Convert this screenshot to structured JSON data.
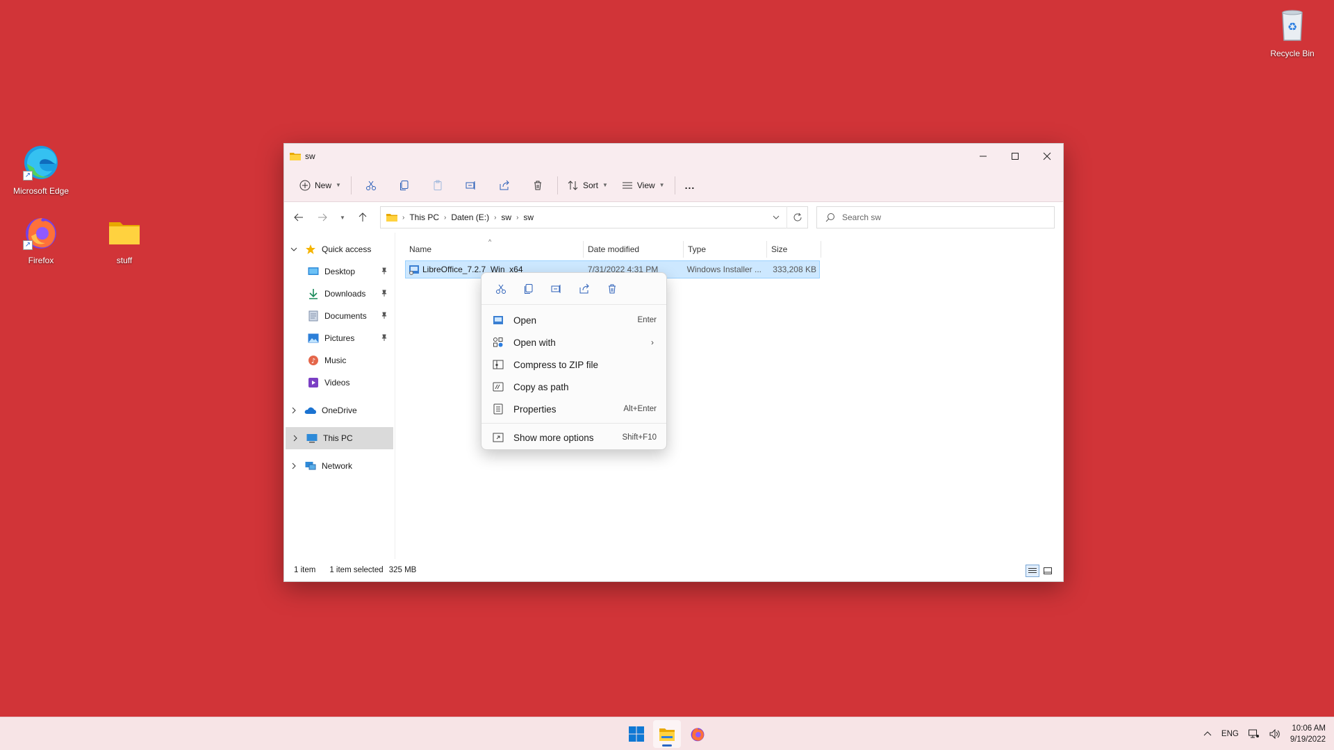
{
  "desktop": {
    "icons": [
      {
        "label": "Microsoft Edge"
      },
      {
        "label": "Firefox"
      },
      {
        "label": "stuff"
      },
      {
        "label": "Recycle Bin"
      }
    ]
  },
  "window": {
    "title": "sw",
    "toolbar": {
      "new_label": "New",
      "sort_label": "Sort",
      "view_label": "View",
      "more_label": "..."
    },
    "address": {
      "crumbs": [
        "This PC",
        "Daten (E:)",
        "sw",
        "sw"
      ]
    },
    "search": {
      "placeholder": "Search sw"
    },
    "nav": {
      "quick_access": "Quick access",
      "items": [
        {
          "label": "Desktop",
          "icon": "desktop-icon"
        },
        {
          "label": "Downloads",
          "icon": "downloads-icon"
        },
        {
          "label": "Documents",
          "icon": "documents-icon"
        },
        {
          "label": "Pictures",
          "icon": "pictures-icon"
        },
        {
          "label": "Music",
          "icon": "music-icon"
        },
        {
          "label": "Videos",
          "icon": "videos-icon"
        }
      ],
      "onedrive": "OneDrive",
      "this_pc": "This PC",
      "network": "Network"
    },
    "columns": {
      "name": "Name",
      "date": "Date modified",
      "type": "Type",
      "size": "Size"
    },
    "files": [
      {
        "name": "LibreOffice_7.2.7_Win_x64",
        "date": "7/31/2022 4:31 PM",
        "type": "Windows Installer ...",
        "size": "333,208 KB"
      }
    ],
    "status": {
      "count": "1 item",
      "selected": "1 item selected",
      "size": "325 MB"
    }
  },
  "context_menu": {
    "items": [
      {
        "label": "Open",
        "shortcut": "Enter"
      },
      {
        "label": "Open with",
        "shortcut": ""
      },
      {
        "label": "Compress to ZIP file",
        "shortcut": ""
      },
      {
        "label": "Copy as path",
        "shortcut": ""
      },
      {
        "label": "Properties",
        "shortcut": "Alt+Enter"
      },
      {
        "label": "Show more options",
        "shortcut": "Shift+F10"
      }
    ]
  },
  "taskbar": {
    "lang": "ENG",
    "time": "10:06 AM",
    "date": "9/19/2022"
  },
  "colors": {
    "desktop_bg": "#d13438",
    "accent": "#0067c0",
    "selection": "#cde8ff"
  }
}
